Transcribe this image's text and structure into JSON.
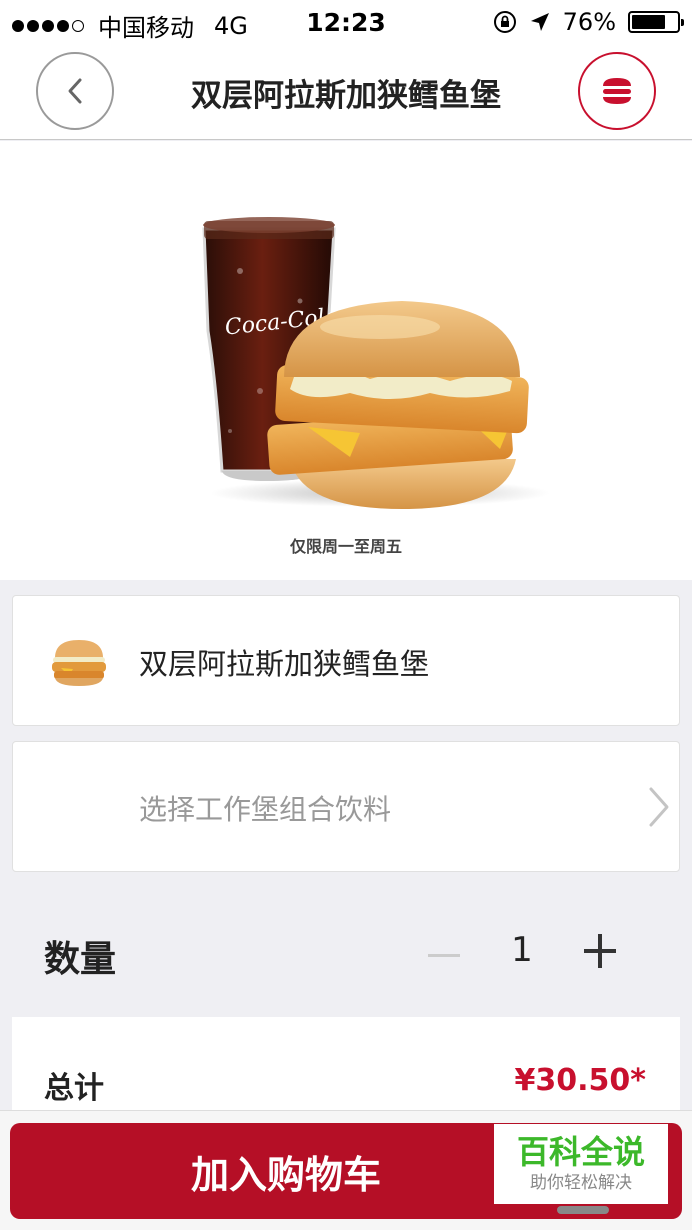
{
  "status_bar": {
    "carrier": "中国移动",
    "network": "4G",
    "time": "12:23",
    "battery": "76%",
    "battery_level": 0.76
  },
  "header": {
    "title": "双层阿拉斯加狭鳕鱼堡"
  },
  "hero": {
    "caption": "仅限周一至周五",
    "cup_logo": "Coca-Cola"
  },
  "item": {
    "name": "双层阿拉斯加狭鳕鱼堡"
  },
  "drink_selector": {
    "label": "选择工作堡组合饮料"
  },
  "quantity": {
    "label": "数量",
    "value": "1"
  },
  "total": {
    "label": "总计",
    "price": "¥30.50*"
  },
  "cart": {
    "button_label": "加入购物车"
  },
  "watermark": {
    "main": "百科全说",
    "sub": "助你轻松解决"
  },
  "colors": {
    "brand_red": "#c8102e",
    "cart_red": "#b50f26",
    "watermark_green": "#3cb82a"
  }
}
